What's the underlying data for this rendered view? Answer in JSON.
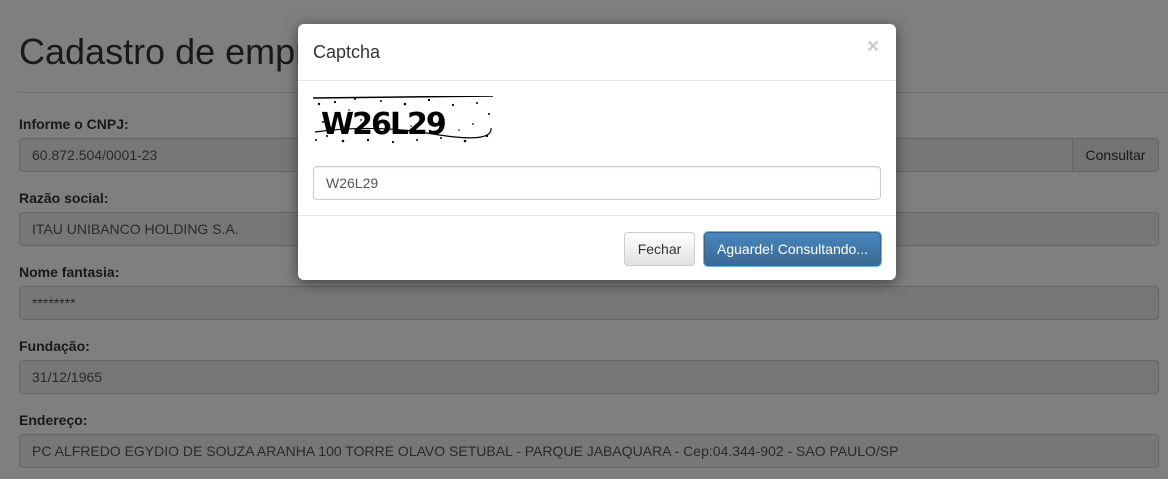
{
  "page": {
    "title": "Cadastro de empresas"
  },
  "form": {
    "cnpj": {
      "label": "Informe o CNPJ:",
      "value": "60.872.504/0001-23",
      "button_label": "Consultar"
    },
    "razao_social": {
      "label": "Razão social:",
      "value": "ITAU UNIBANCO HOLDING S.A."
    },
    "nome_fantasia": {
      "label": "Nome fantasia:",
      "value": "********"
    },
    "fundacao": {
      "label": "Fundação:",
      "value": "31/12/1965"
    },
    "endereco": {
      "label": "Endereço:",
      "value": "PC ALFREDO EGYDIO DE SOUZA ARANHA 100 TORRE OLAVO SETUBAL - PARQUE JABAQUARA - Cep:04.344-902 - SAO PAULO/SP"
    }
  },
  "modal": {
    "title": "Captcha",
    "close_symbol": "×",
    "captcha_text": "W26L29",
    "input_value": "W26L29",
    "cancel_label": "Fechar",
    "submit_label": "Aguarde! Consultando..."
  },
  "colors": {
    "primary": "#337ab7",
    "backdrop": "#000000",
    "readonly_input": "#eeeeee"
  }
}
